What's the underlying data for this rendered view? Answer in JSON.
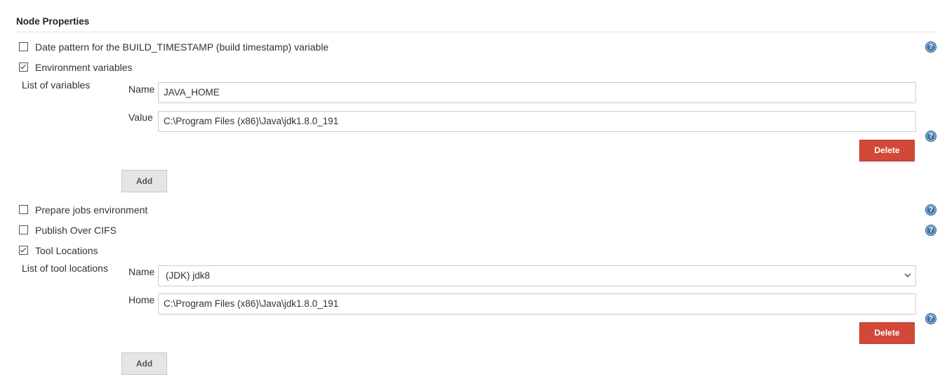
{
  "section": {
    "title": "Node Properties"
  },
  "options": {
    "date_pattern": {
      "label": "Date pattern for the BUILD_TIMESTAMP (build timestamp) variable",
      "checked": false
    },
    "env_vars": {
      "label": "Environment variables",
      "checked": true
    },
    "prepare_jobs": {
      "label": "Prepare jobs environment",
      "checked": false
    },
    "publish_cifs": {
      "label": "Publish Over CIFS",
      "checked": false
    },
    "tool_locations": {
      "label": "Tool Locations",
      "checked": true
    }
  },
  "env_vars": {
    "list_label": "List of variables",
    "name_label": "Name",
    "name_value": "JAVA_HOME",
    "value_label": "Value",
    "value_value": "C:\\Program Files (x86)\\Java\\jdk1.8.0_191",
    "delete_label": "Delete",
    "add_label": "Add"
  },
  "tool_locations": {
    "list_label": "List of tool locations",
    "name_label": "Name",
    "name_selected": "(JDK) jdk8",
    "home_label": "Home",
    "home_value": "C:\\Program Files (x86)\\Java\\jdk1.8.0_191",
    "delete_label": "Delete",
    "add_label": "Add"
  },
  "help": {
    "glyph": "?"
  },
  "colors": {
    "delete_bg": "#d24939",
    "add_bg": "#e5e5e5",
    "help_icon": "#3f73a8"
  }
}
